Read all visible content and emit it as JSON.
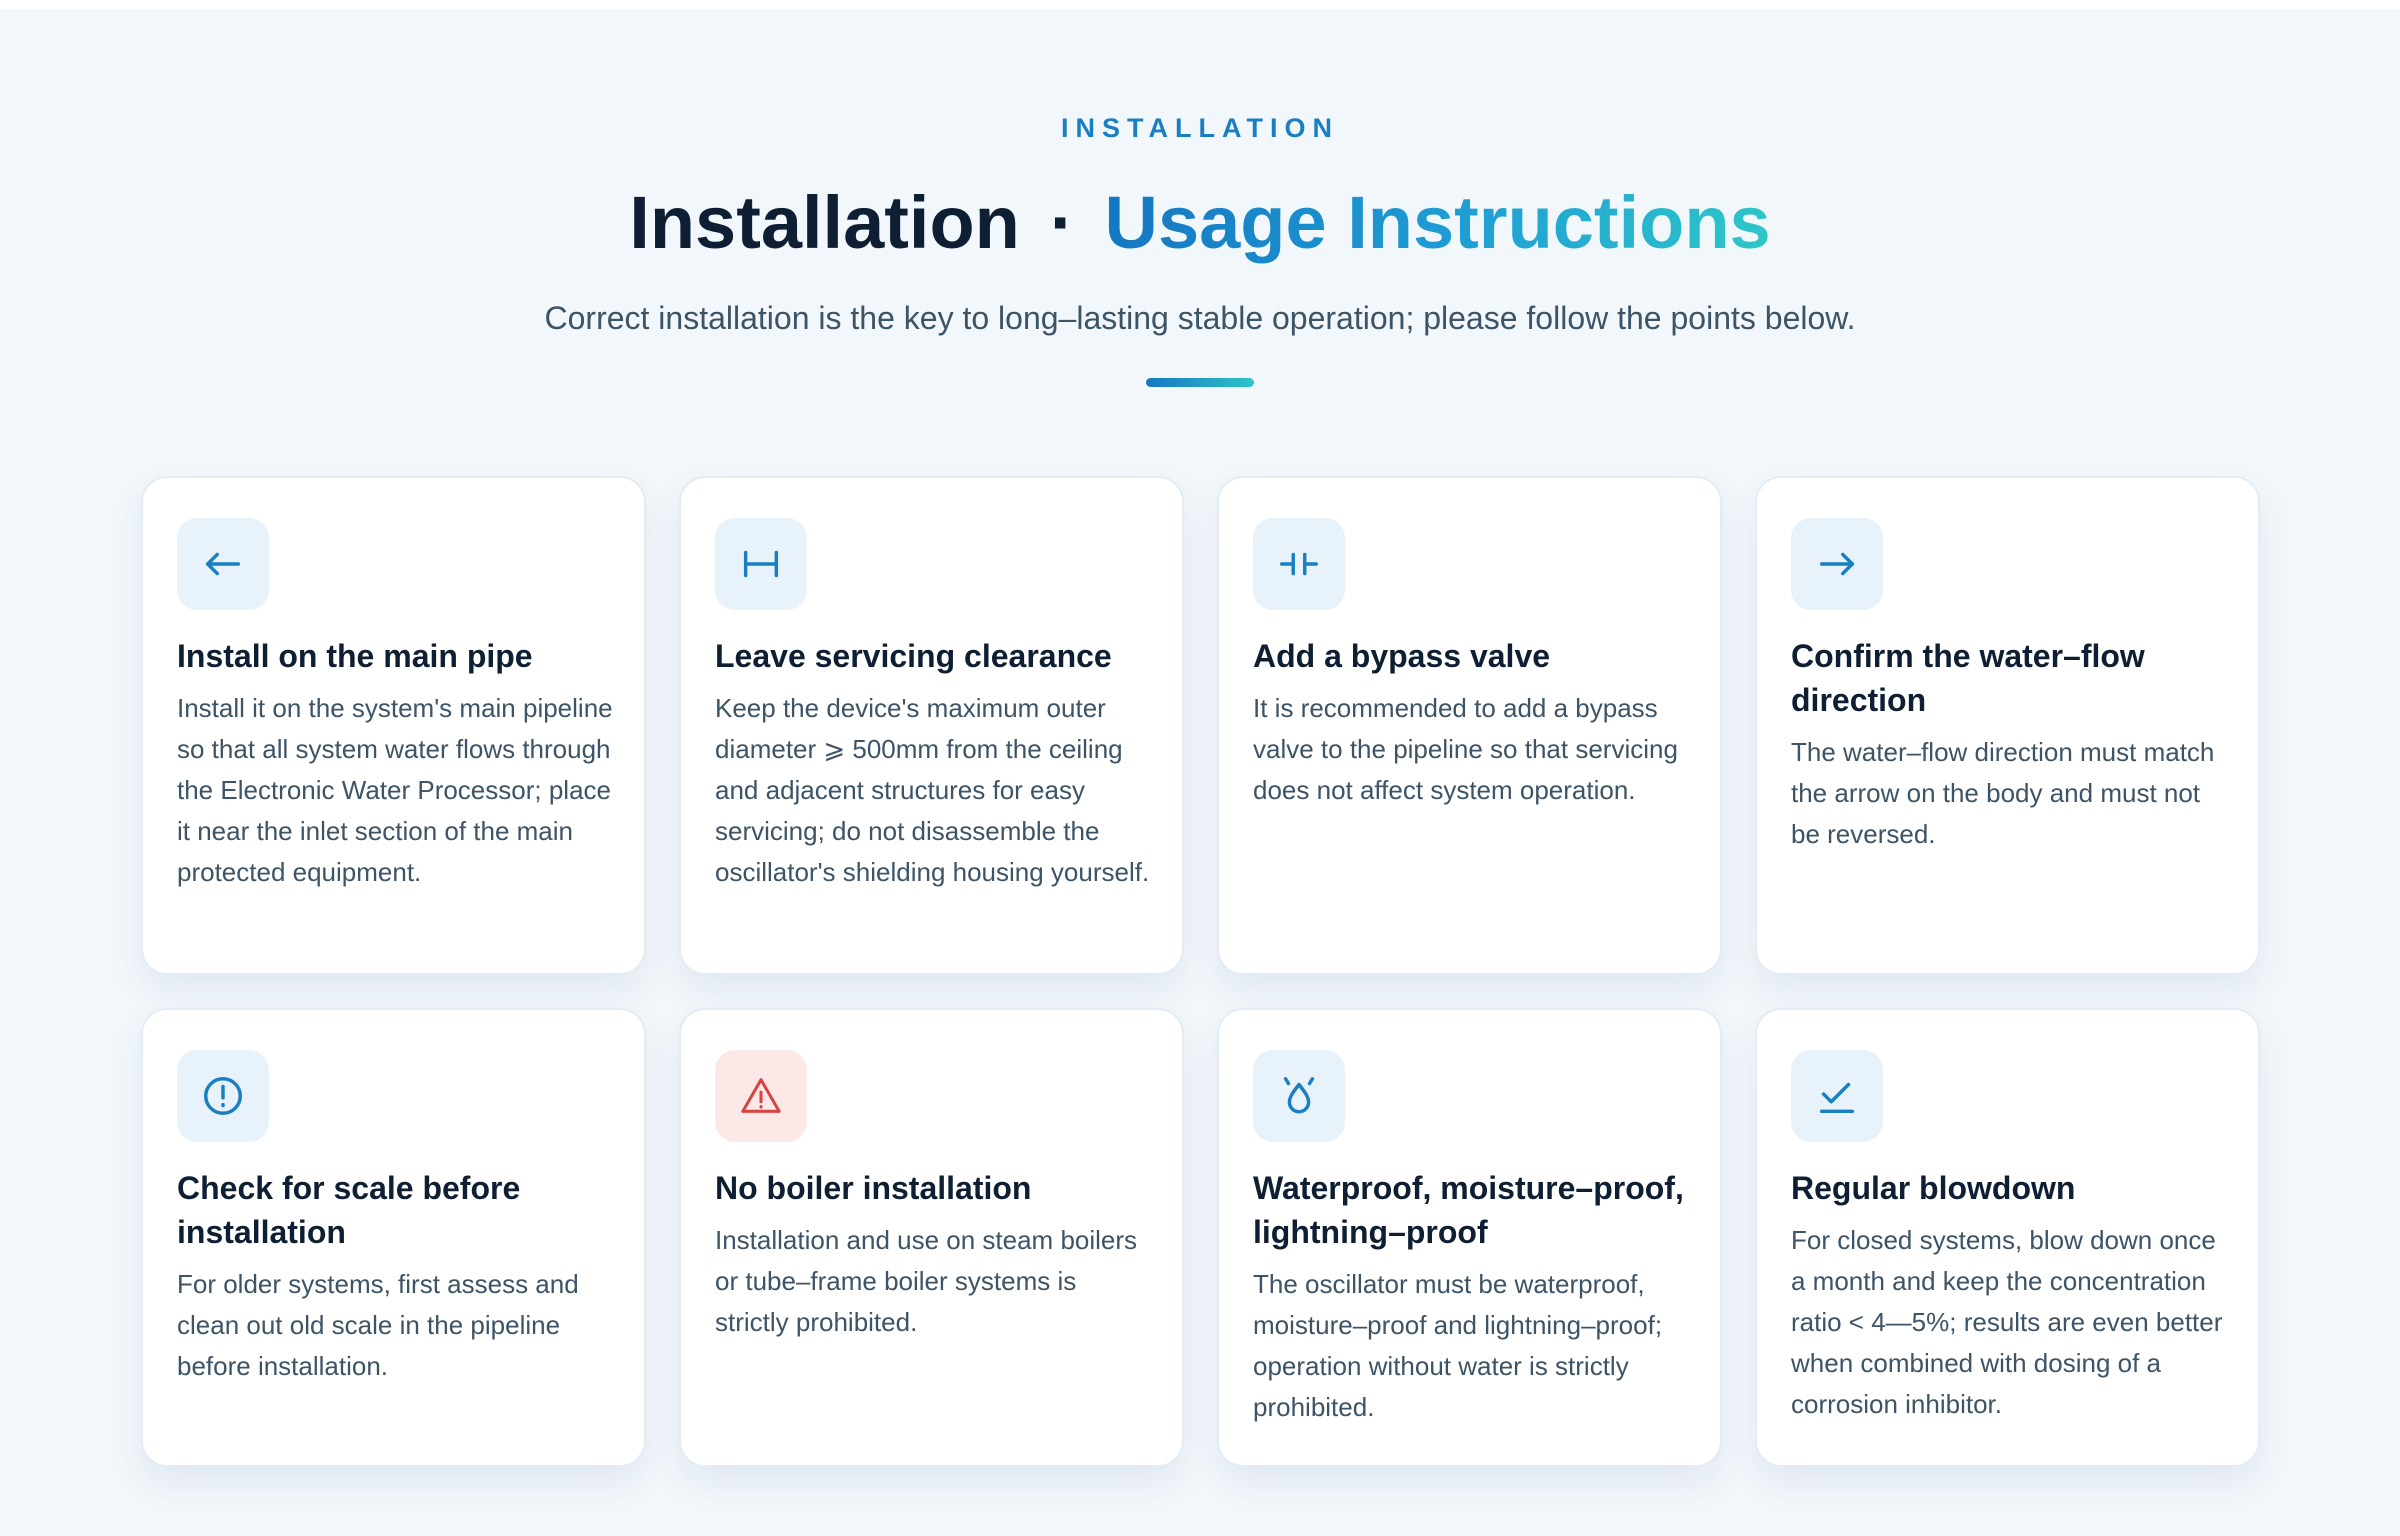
{
  "header": {
    "eyebrow": "INSTALLATION",
    "title_part1": "Installation",
    "title_separator": "·",
    "title_part2": "Usage Instructions",
    "subtitle": "Correct installation is the key to long–lasting stable operation; please follow the points below."
  },
  "colors": {
    "accent": "#1a7fc1",
    "gradient_start": "#1577c2",
    "gradient_end": "#2ec6c8",
    "warning": "#d64545",
    "background": "#f2f7fb"
  },
  "cards": [
    {
      "icon": "arrow-left-icon",
      "title": "Install on the main pipe",
      "text": "Install it on the system's main pipeline so that all system water flows through the Electronic Water Processor; place it near the inlet section of the main protected equipment."
    },
    {
      "icon": "clearance-icon",
      "title": "Leave servicing clearance",
      "text": "Keep the device's maximum outer diameter ⩾ 500mm from the ceiling and adjacent structures for easy servicing; do not disassemble the oscillator's shielding housing yourself."
    },
    {
      "icon": "bypass-valve-icon",
      "title": "Add a bypass valve",
      "text": "It is recommended to add a bypass valve to the pipeline so that servicing does not affect system operation."
    },
    {
      "icon": "arrow-right-icon",
      "title": "Confirm the water–flow direction",
      "text": "The water–flow direction must match the arrow on the body and must not be reversed."
    },
    {
      "icon": "alert-circle-icon",
      "title": "Check for scale before installation",
      "text": "For older systems, first assess and clean out old scale in the pipeline before installation."
    },
    {
      "icon": "warning-triangle-icon",
      "title": "No boiler installation",
      "text": "Installation and use on steam boilers or tube–frame boiler systems is strictly prohibited."
    },
    {
      "icon": "water-drop-icon",
      "title": "Waterproof, moisture–proof, lightning–proof",
      "text": "The oscillator must be waterproof, moisture–proof and lightning–proof; operation without water is strictly prohibited."
    },
    {
      "icon": "checkmark-icon",
      "title": "Regular blowdown",
      "text": "For closed systems, blow down once a month and keep the concentration ratio < 4—5%; results are even better when combined with dosing of a corrosion inhibitor."
    }
  ]
}
